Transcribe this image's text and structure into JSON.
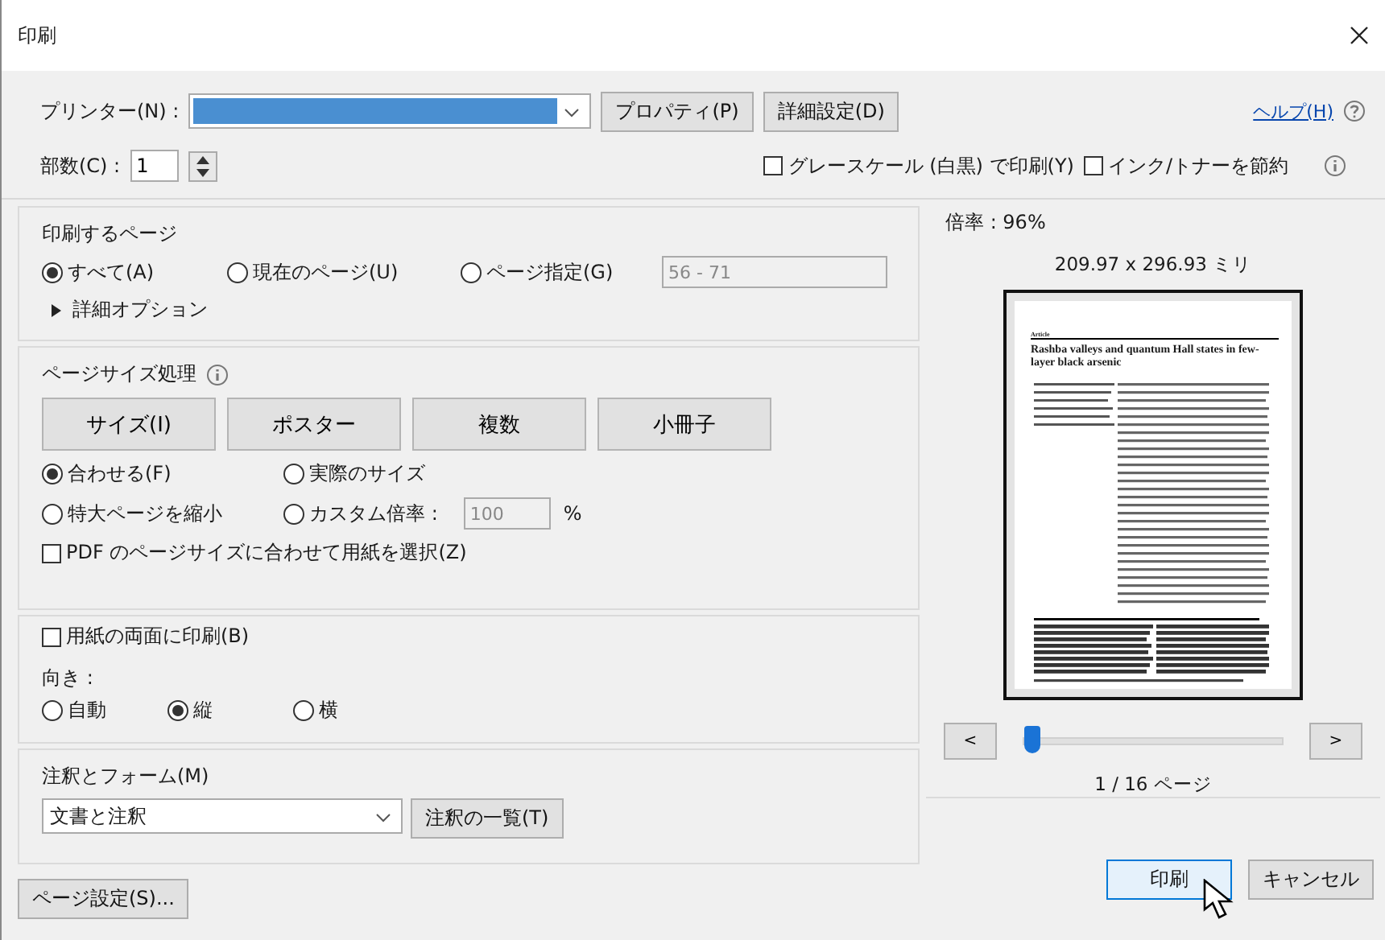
{
  "window": {
    "title": "印刷"
  },
  "printer": {
    "label": "プリンター(N) :",
    "selected": true
  },
  "top_buttons": [
    "プロパティ(P)",
    "詳細設定(D)"
  ],
  "help": "ヘルプ(H)",
  "copies": {
    "label": "部数(C) :",
    "value": "1"
  },
  "options": [
    {
      "label": "グレースケール (白黒) で印刷(Y)",
      "checked": false
    },
    {
      "label": "インク/トナーを節約",
      "checked": false
    }
  ],
  "pages": {
    "title": "印刷するページ",
    "choices": [
      {
        "label": "すべて(A)",
        "selected": true
      },
      {
        "label": "現在のページ(U)",
        "selected": false
      },
      {
        "label": "ページ指定(G)",
        "selected": false
      }
    ],
    "range": "56 - 71",
    "more": "詳細オプション",
    "expanded": false
  },
  "size": {
    "title": "ページサイズ処理",
    "modes": [
      "サイズ(I)",
      "ポスター",
      "複数",
      "小冊子"
    ],
    "choices": [
      {
        "label": "合わせる(F)",
        "selected": true
      },
      {
        "label": "実際のサイズ",
        "selected": false
      },
      {
        "label": "特大ページを縮小",
        "selected": false
      },
      {
        "label": "カスタム倍率 :",
        "selected": false
      }
    ],
    "scale": "100",
    "unit": "%",
    "paper": {
      "label": "PDF のページサイズに合わせて用紙を選択(Z)",
      "checked": false
    }
  },
  "duplex": {
    "label": "用紙の両面に印刷(B)",
    "checked": false
  },
  "orientation": {
    "label": "向き :",
    "choices": [
      {
        "label": "自動",
        "selected": false
      },
      {
        "label": "縦",
        "selected": true
      },
      {
        "label": "横",
        "selected": false
      }
    ]
  },
  "comments": {
    "title": "注釈とフォーム(M)",
    "value": "文書と注釈",
    "button": "注釈の一覧(T)"
  },
  "preview": {
    "scale": "倍率 : 96%",
    "size": "209.97 x 296.93 ミリ",
    "doc_kind": "Article",
    "doc_title": "Rashba valleys and quantum Hall states in few-layer black arsenic",
    "prev": "<",
    "next": ">",
    "level": 0,
    "page": "1 / 16 ページ"
  },
  "page_setup": "ページ設定(S)...",
  "actions": [
    {
      "label": "印刷",
      "default": true
    },
    {
      "label": "キャンセル",
      "default": false
    }
  ]
}
